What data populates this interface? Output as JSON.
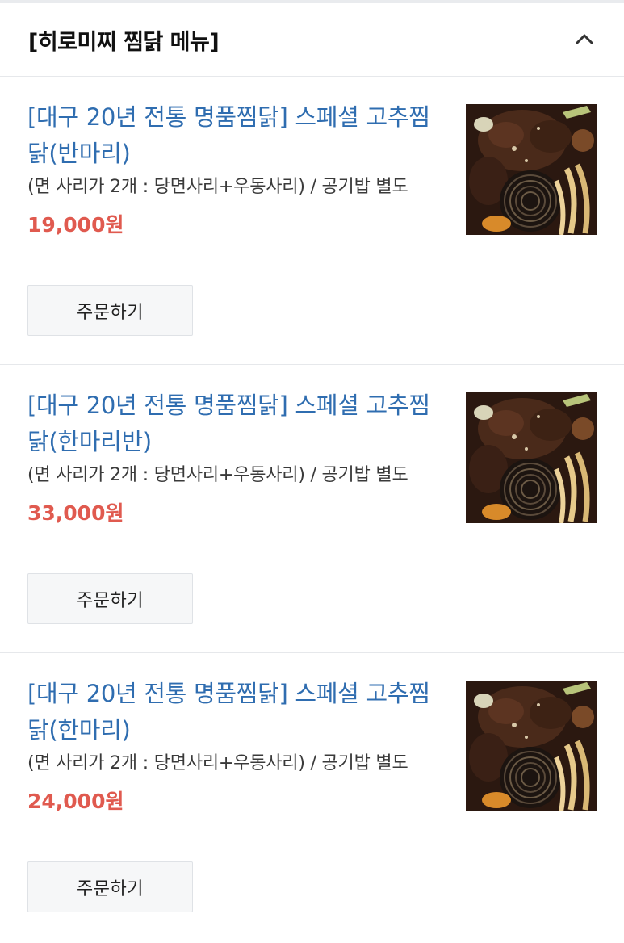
{
  "header": {
    "title": "[히로미찌 찜닭 메뉴]",
    "collapse_icon": "chevron-up-icon"
  },
  "menu": {
    "items": [
      {
        "name": "[대구 20년 전통 명품찜닭] 스페셜 고추찜닭(반마리)",
        "description": "(면 사리가 2개 : 당면사리+우동사리) / 공기밥 별도",
        "price": "19,000원",
        "order_label": "주문하기",
        "photo": "braised-chicken-photo"
      },
      {
        "name": "[대구 20년 전통 명품찜닭] 스페셜 고추찜닭(한마리반)",
        "description": "(면 사리가 2개 : 당면사리+우동사리) / 공기밥 별도",
        "price": "33,000원",
        "order_label": "주문하기",
        "photo": "braised-chicken-photo"
      },
      {
        "name": "[대구 20년 전통 명품찜닭] 스페셜 고추찜닭(한마리)",
        "description": "(면 사리가 2개 : 당면사리+우동사리) / 공기밥 별도",
        "price": "24,000원",
        "order_label": "주문하기",
        "photo": "braised-chicken-photo"
      }
    ]
  },
  "colors": {
    "name": "#2f6db0",
    "price": "#e05a4f",
    "divider": "#e6e8eb"
  }
}
